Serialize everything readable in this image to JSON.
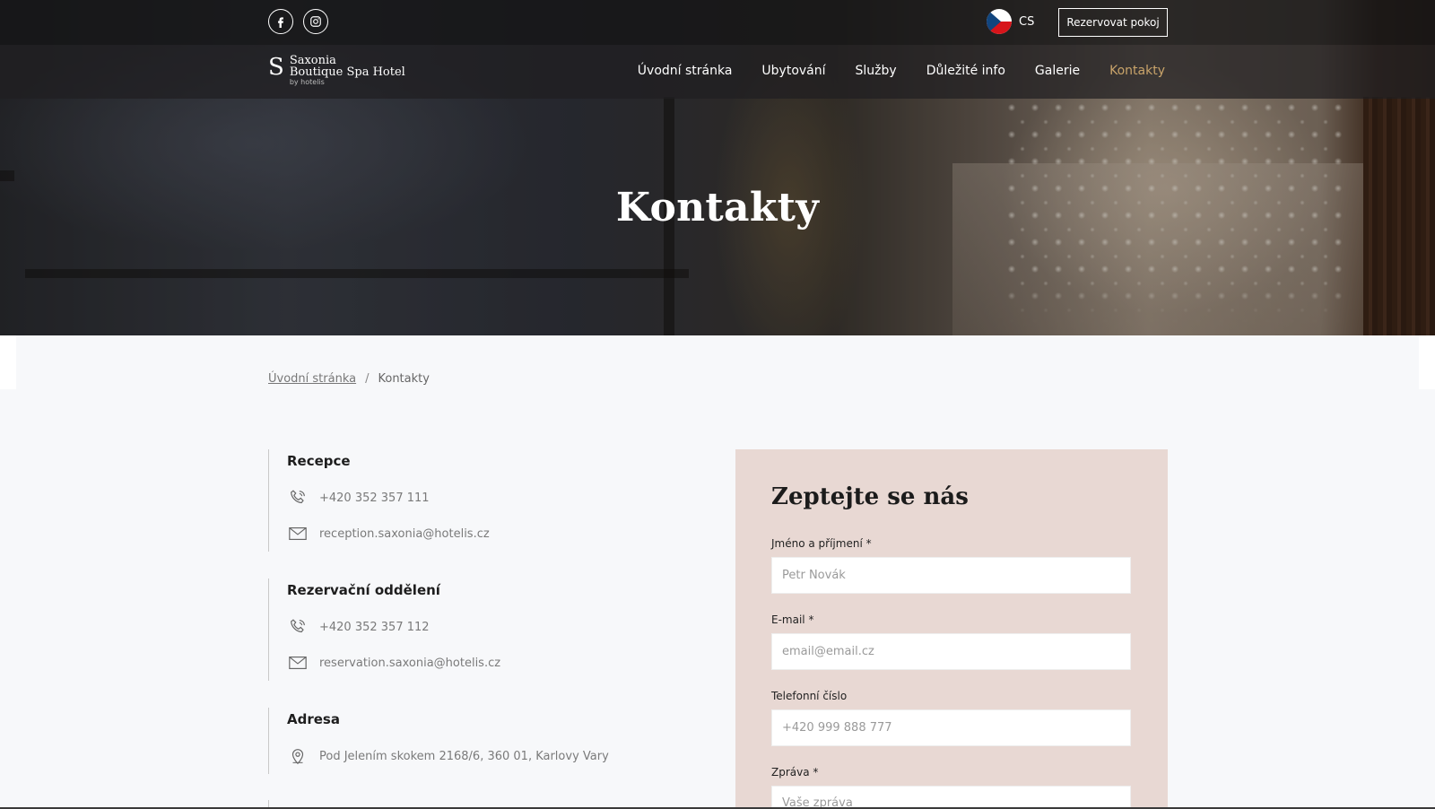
{
  "hero": {
    "title": "Kontakty"
  },
  "topbar": {
    "social": [
      "facebook-icon",
      "instagram-icon"
    ],
    "lang_code": "CS",
    "book_label": "Rezervovat pokoj"
  },
  "logo": {
    "line1": "Saxonia",
    "line2": "Boutique Spa Hotel",
    "sub": "by hotelis"
  },
  "nav": {
    "items": [
      {
        "label": "Úvodní stránka"
      },
      {
        "label": "Ubytování"
      },
      {
        "label": "Služby"
      },
      {
        "label": "Důležité info"
      },
      {
        "label": "Galerie"
      },
      {
        "label": "Kontakty",
        "active": true
      }
    ],
    "active_color": "#c9a46a"
  },
  "breadcrumb": {
    "home": "Úvodní stránka",
    "sep": "/",
    "current": "Kontakty"
  },
  "contacts": {
    "reception": {
      "title": "Recepce",
      "phone": "+420 352 357 111",
      "email": "reception.saxonia@hotelis.cz"
    },
    "reservation": {
      "title": "Rezervační oddělení",
      "phone": "+420 352 357 112",
      "email": "reservation.saxonia@hotelis.cz"
    },
    "address": {
      "title": "Adresa",
      "value": "Pod Jelením skokem 2168/6, 360 01, Karlovy Vary"
    }
  },
  "form": {
    "title": "Zeptejte se nás",
    "name_label": "Jméno a příjmení *",
    "name_placeholder": "Petr Novák",
    "email_label": "E-mail *",
    "email_placeholder": "email@email.cz",
    "phone_label": "Telefonní číslo",
    "phone_placeholder": "+420 999 888 777",
    "message_label": "Zpráva *",
    "message_placeholder": "Vaše zpráva",
    "background": "#e8d8d3"
  }
}
